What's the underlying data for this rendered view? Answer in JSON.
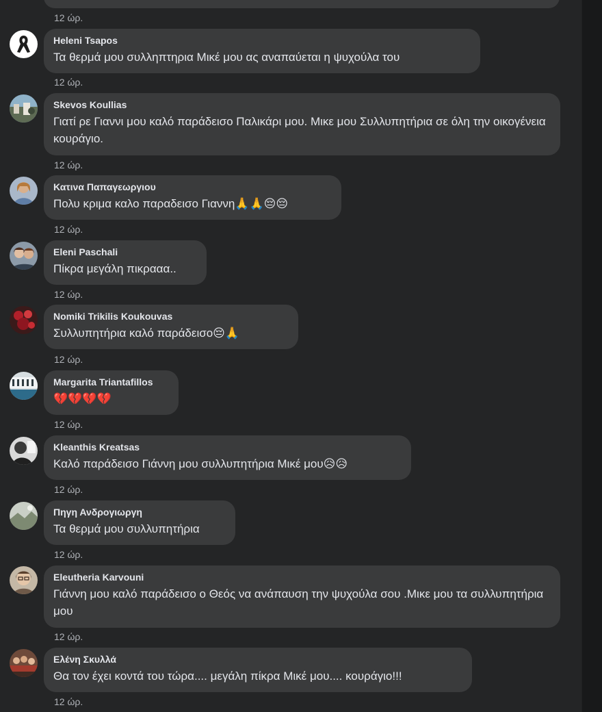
{
  "page": {
    "time_label": "12 ώρ."
  },
  "top": {
    "time": "12 ώρ."
  },
  "comments": [
    {
      "author": "Heleni Tsapos",
      "text": "Τα θερμά μου συλληπτηρια Μικέ μου ας αναπαύεται η ψυχούλα του",
      "time": "12 ώρ.",
      "avatar": "black-ribbon"
    },
    {
      "author": "Skevos Koullias",
      "text": "Γιατί ρε Γιαννι μου καλό παράδεισο Παλικάρι μου. Μικε μου Συλλυπητήρια σε όλη την οικογένεια κουράγιο.",
      "time": "12 ώρ.",
      "avatar": "outdoor-photo"
    },
    {
      "author": "Κατινα Παπαγεωργιου",
      "text": "Πολυ κριμα καλο παραδεισο Γιαννη🙏🙏😔😔",
      "time": "12 ώρ.",
      "avatar": "woman-photo"
    },
    {
      "author": "Eleni Paschali",
      "text": "Πίκρα μεγάλη πικρααα..",
      "time": "12 ώρ.",
      "avatar": "two-women-photo"
    },
    {
      "author": "Nomiki Trikilis Koukouvas",
      "text": "Συλλυπητήρια καλό παράδεισο😔🙏",
      "time": "12 ώρ.",
      "avatar": "red-flowers-photo"
    },
    {
      "author": "Margarita Triantafillos",
      "text": "💔💔💔💔",
      "time": "12 ώρ.",
      "avatar": "building-photo"
    },
    {
      "author": "Kleanthis Kreatsas",
      "text": "Καλό παράδεισο Γιάννη μου συλλυπητήρια Μικέ μου😥😥",
      "time": "12 ώρ.",
      "avatar": "bw-photo"
    },
    {
      "author": "Πηγη Ανδρογιωργη",
      "text": "Τα θερμά μου συλλυπητήρια",
      "time": "12 ώρ.",
      "avatar": "landscape-photo"
    },
    {
      "author": "Eleutheria Karvouni",
      "text": "Γιάννη μου καλό παράδεισο ο Θεός να ανάπαυση την ψυχούλα σου .Μικε μου τα συλλυπητήρια μου",
      "time": "12 ώρ.",
      "avatar": "woman-glasses-photo"
    },
    {
      "author": "Ελένη Σκυλλά",
      "text": "Θα τον έχει κοντά του τώρα.... μεγάλη πίκρα Μικέ μου.... κουράγιο!!!",
      "time": "12 ώρ.",
      "avatar": "group-photo"
    }
  ],
  "colors": {
    "background": "#242526",
    "bubble": "#3a3b3c",
    "text": "#e4e6eb",
    "secondary_text": "#b0b3b8"
  }
}
